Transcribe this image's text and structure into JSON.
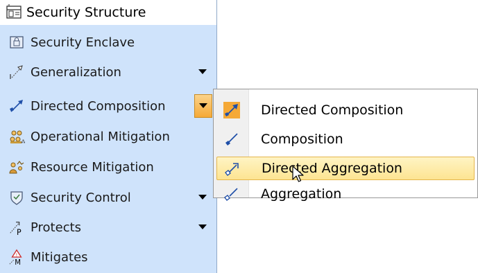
{
  "palette": {
    "header": {
      "label": "Security Structure",
      "icon": "security-structure-icon"
    },
    "items": [
      {
        "label": "Security Enclave",
        "icon": "security-enclave-icon",
        "has_dropdown": false
      },
      {
        "label": "Generalization",
        "icon": "generalization-icon",
        "has_dropdown": true
      },
      {
        "label": "Directed Composition",
        "icon": "directed-composition-icon",
        "has_dropdown": true,
        "dropdown_open": true
      },
      {
        "label": "Operational Mitigation",
        "icon": "operational-mitigation-icon",
        "has_dropdown": false
      },
      {
        "label": "Resource Mitigation",
        "icon": "resource-mitigation-icon",
        "has_dropdown": false
      },
      {
        "label": "Security Control",
        "icon": "security-control-icon",
        "has_dropdown": true
      },
      {
        "label": "Protects",
        "icon": "protects-icon",
        "icon_letter": "P",
        "has_dropdown": true
      },
      {
        "label": "Mitigates",
        "icon": "mitigates-icon",
        "icon_letter": "M",
        "has_dropdown": false
      }
    ]
  },
  "menu": {
    "items": [
      {
        "label": "Directed Composition",
        "icon": "directed-composition-icon"
      },
      {
        "label": "Composition",
        "icon": "composition-icon"
      },
      {
        "label": "Directed Aggregation",
        "icon": "directed-aggregation-icon",
        "selected": true
      },
      {
        "label": "Aggregation",
        "icon": "aggregation-icon"
      }
    ]
  },
  "colors": {
    "palette_background": "#cfe3fb",
    "menu_highlight": "#fde492",
    "icon_blue": "#1f4fa8",
    "icon_orange": "#f5a937"
  }
}
